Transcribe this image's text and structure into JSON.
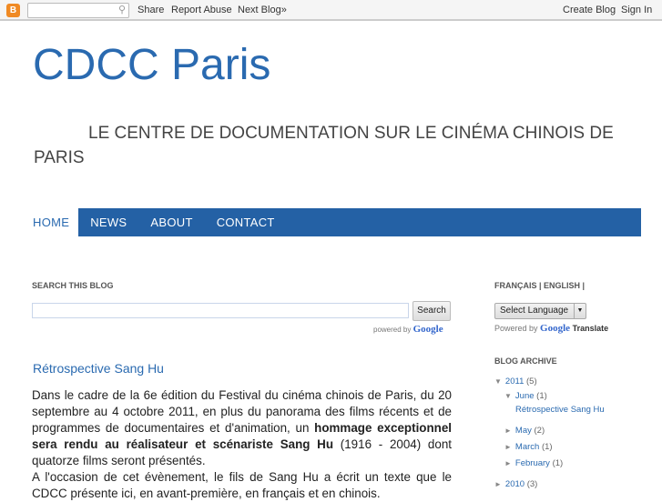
{
  "topbar": {
    "search_icon": "magnifier-icon",
    "share": "Share",
    "report": "Report Abuse",
    "next": "Next Blog»",
    "create": "Create Blog",
    "signin": "Sign In"
  },
  "blog": {
    "title": "CDCC Paris",
    "description": "LE CENTRE DE DOCUMENTATION SUR LE CINÉMA CHINOIS DE PARIS"
  },
  "menu": [
    "HOME",
    "NEWS",
    "ABOUT",
    "CONTACT"
  ],
  "search": {
    "heading": "SEARCH THIS BLOG",
    "button": "Search",
    "powered": "powered by",
    "google": "Google"
  },
  "post": {
    "title": "Rétrospective Sang Hu",
    "p1a": "Dans le cadre de la 6e édition du Festival du cinéma chinois de Paris, du 20 septembre au 4 octobre 2011, en plus du panorama des films récents et de programmes de documentaires et d'animation, un ",
    "p1b": "hommage exceptionnel sera rendu au réalisateur et scénariste  Sang Hu",
    "p1c": " (1916 - 2004) dont quatorze films seront présentés.",
    "p2": "A l'occasion de cet évènement, le fils de Sang Hu a écrit un texte que le CDCC présente ici, en avant-première, en français et en chinois."
  },
  "sidebar": {
    "lang_heading": "FRANÇAIS | ENGLISH |",
    "select": "Select Language",
    "powered": "Powered by",
    "google": "Google",
    "translate": "Translate",
    "archive_heading": "BLOG ARCHIVE",
    "archive": {
      "y2011": "2011",
      "c2011": "(5)",
      "june": "June",
      "cjune": "(1)",
      "post": "Rétrospective Sang Hu",
      "may": "May",
      "cmay": "(2)",
      "march": "March",
      "cmarch": "(1)",
      "feb": "February",
      "cfeb": "(1)",
      "y2010": "2010",
      "c2010": "(3)"
    }
  }
}
